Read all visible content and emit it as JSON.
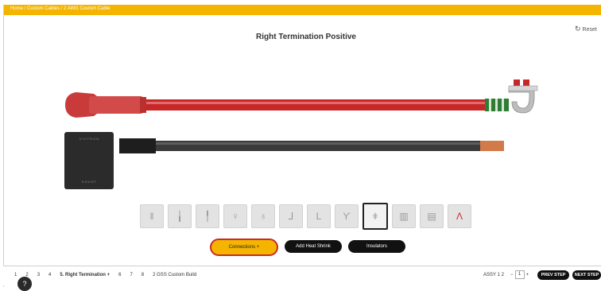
{
  "breadcrumb": "Home / Custom Cables / 2 AWG Custom Cable",
  "title": "Right Termination Positive",
  "reset_label": "Reset",
  "reset_icon": "refresh-icon",
  "colors": {
    "accent": "#f4b400",
    "positive_cable": "#c62828",
    "negative_cable": "#3a3a3a",
    "heat_shrink": "#2e7d32"
  },
  "connectors": [
    {
      "icon": "ring-terminal-icon-1",
      "glyph": "‖"
    },
    {
      "icon": "ring-terminal-icon-2",
      "glyph": "╽"
    },
    {
      "icon": "ring-terminal-icon-3",
      "glyph": "╿"
    },
    {
      "icon": "ring-terminal-icon-4",
      "glyph": "♀"
    },
    {
      "icon": "ring-terminal-icon-5",
      "glyph": "♁"
    },
    {
      "icon": "angled-terminal-icon-1",
      "glyph": "⅃"
    },
    {
      "icon": "angled-terminal-icon-2",
      "glyph": "L"
    },
    {
      "icon": "battery-clamp-icon",
      "glyph": "ϒ"
    },
    {
      "icon": "battery-clamp-selected-icon",
      "glyph": "ǂ"
    },
    {
      "icon": "block-terminal-icon-1",
      "glyph": "▥"
    },
    {
      "icon": "block-terminal-icon-2",
      "glyph": "▤"
    },
    {
      "icon": "clamp-red-icon",
      "glyph": "Ʌ"
    }
  ],
  "actions": {
    "connections": "Connections +",
    "heat_shrink": "Add Heat Shrink",
    "insulation": "Insulators"
  },
  "steps": [
    {
      "label": "1"
    },
    {
      "label": "2"
    },
    {
      "label": "3"
    },
    {
      "label": "4"
    },
    {
      "label": "5. Right Termination +"
    },
    {
      "label": "6"
    },
    {
      "label": "7"
    },
    {
      "label": "8"
    },
    {
      "label": "2 GSS Custom Build"
    }
  ],
  "footer": {
    "count": "ASSY 1 2",
    "qty": "1",
    "prev": "PREV STEP",
    "next": "NEXT STEP"
  }
}
